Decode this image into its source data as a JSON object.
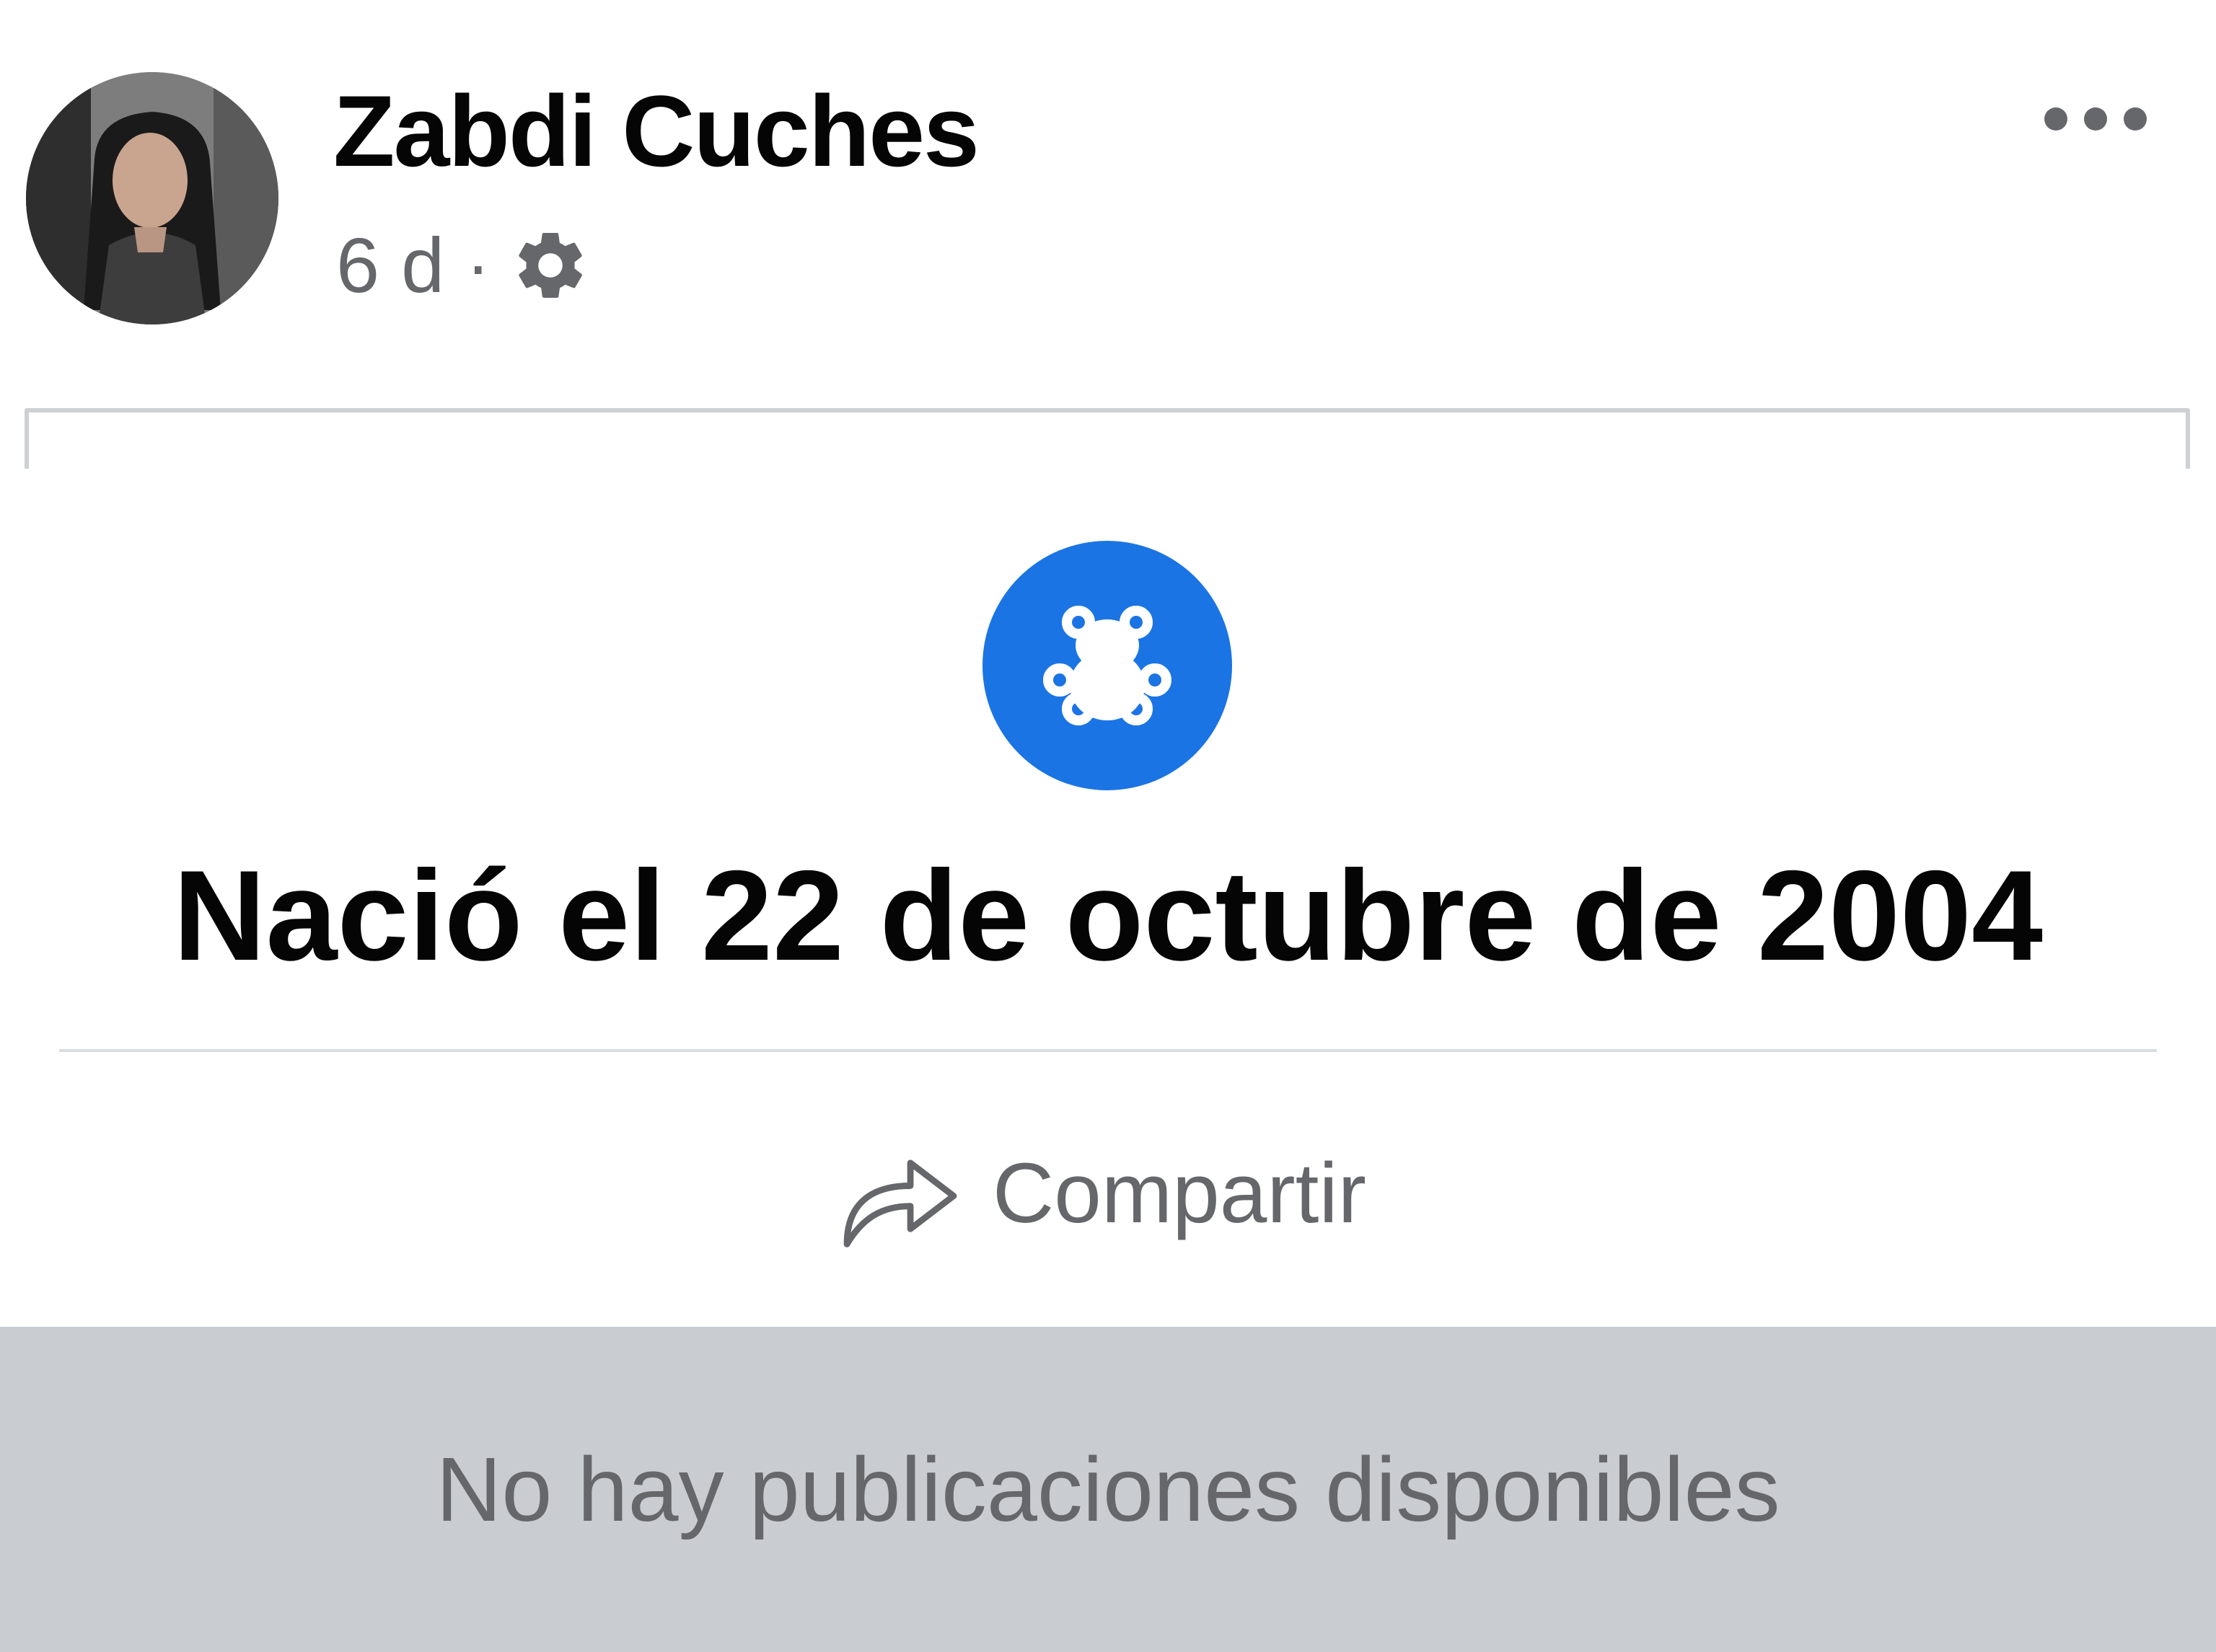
{
  "post": {
    "author_name": "Zabdi Cuches",
    "time_ago": "6 d",
    "separator": "·",
    "audience_icon": "gear-icon",
    "more_icon": "more-dots-icon"
  },
  "life_event": {
    "icon": "teddy-bear-icon",
    "icon_color": "#1b74e4",
    "title": "Nació el 22 de octubre de 2004"
  },
  "actions": {
    "share_label": "Compartir",
    "share_icon": "share-arrow-icon"
  },
  "empty_state": {
    "message": "No hay publicaciones disponibles"
  }
}
